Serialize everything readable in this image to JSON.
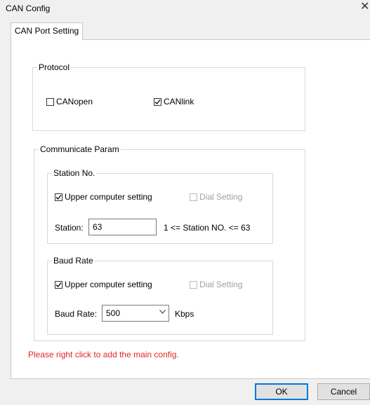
{
  "window": {
    "title": "CAN Config"
  },
  "tabs": [
    {
      "label": "CAN Port Setting"
    }
  ],
  "protocol": {
    "legend": "Protocol",
    "canopen": {
      "label": "CANopen",
      "checked": false
    },
    "canlink": {
      "label": "CANlink",
      "checked": true
    }
  },
  "communicate": {
    "legend": "Communicate Param",
    "station_group": {
      "legend": "Station No.",
      "upper_setting": {
        "label": "Upper computer setting",
        "checked": true
      },
      "dial_setting": {
        "label": "Dial Setting",
        "checked": false,
        "disabled": true
      },
      "station_label": "Station:",
      "station_value": "63",
      "range_hint": "1 <= Station NO. <= 63"
    },
    "baud_group": {
      "legend": "Baud Rate",
      "upper_setting": {
        "label": "Upper computer setting",
        "checked": true
      },
      "dial_setting": {
        "label": "Dial Setting",
        "checked": false,
        "disabled": true
      },
      "baud_label": "Baud Rate:",
      "baud_value": "500",
      "unit": "Kbps"
    }
  },
  "warning": "Please right click to add the main config.",
  "buttons": {
    "ok": "OK",
    "cancel": "Cancel"
  },
  "colors": {
    "warning": "#e52424",
    "default_button_border": "#0078d7"
  }
}
